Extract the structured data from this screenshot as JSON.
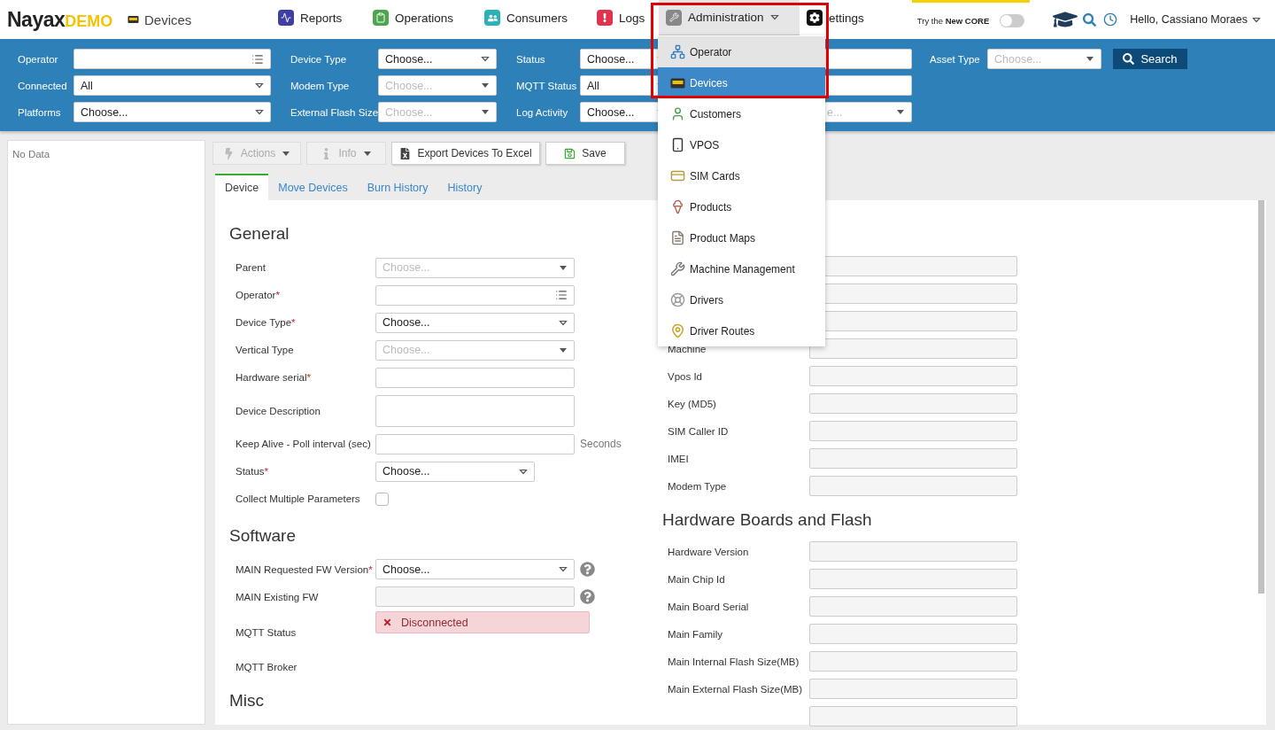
{
  "header": {
    "logo": {
      "brand": "Nayax",
      "badge": "DEMO"
    },
    "page_title": "Devices",
    "nav": [
      {
        "label": "Reports",
        "kind": "reports",
        "selected": false
      },
      {
        "label": "Operations",
        "kind": "operations",
        "selected": false
      },
      {
        "label": "Consumers",
        "kind": "consumers",
        "selected": false
      },
      {
        "label": "Logs",
        "kind": "logs",
        "selected": false
      },
      {
        "label": "Administration",
        "kind": "administration",
        "selected": true
      },
      {
        "label": "ettings",
        "kind": "settings",
        "selected": false
      }
    ],
    "try_core": {
      "label": "Try the **New CORE**",
      "on": false
    },
    "greeting": "Hello, Cassiano Moraes"
  },
  "filters": {
    "columns": [
      {
        "rows": [
          {
            "label": "Operator",
            "kind": "list"
          },
          {
            "label": "Connected",
            "kind": "select",
            "value": "All"
          },
          {
            "label": "Platforms",
            "kind": "select",
            "value": "Choose..."
          }
        ]
      },
      {
        "rows": [
          {
            "label": "Device Type",
            "kind": "select",
            "value": "Choose..."
          },
          {
            "label": "Modem Type",
            "kind": "select",
            "placeholder": "Choose..."
          },
          {
            "label": "External Flash Size",
            "kind": "select",
            "placeholder": "Choose..."
          }
        ]
      },
      {
        "rows": [
          {
            "label": "Status",
            "kind": "select",
            "value": "Choose..."
          },
          {
            "label": "MQTT Status",
            "kind": "select",
            "value": "All"
          },
          {
            "label": "Log Activity",
            "kind": "select",
            "value": "Choose..."
          }
        ]
      },
      {
        "rows": [
          {
            "kind": "text"
          },
          {
            "kind": "text"
          },
          {
            "kind": "select",
            "placeholder": "e..."
          }
        ]
      },
      {
        "rows": [
          {
            "label": "Asset Type",
            "kind": "select",
            "placeholder": "Choose..."
          }
        ]
      }
    ],
    "search_button": "Search"
  },
  "tree_panel": {
    "empty_text": "No Data"
  },
  "toolbar": [
    {
      "label": "Actions",
      "kind": "actions",
      "disabled": true
    },
    {
      "label": "Info",
      "kind": "info",
      "disabled": true
    },
    {
      "label": "Export Devices To Excel",
      "kind": "export",
      "disabled": false
    },
    {
      "label": "Save",
      "kind": "save",
      "disabled": false
    }
  ],
  "tabs": [
    {
      "label": "Device",
      "selected": true
    },
    {
      "label": "Move Devices",
      "selected": false
    },
    {
      "label": "Burn History",
      "selected": false
    },
    {
      "label": "History",
      "selected": false
    }
  ],
  "form": {
    "left": [
      {
        "title": "General",
        "fields": [
          {
            "label": "Parent",
            "kind": "select",
            "placeholder": "Choose..."
          },
          {
            "label": "Operator",
            "mark": "*",
            "kind": "list"
          },
          {
            "label": "Device Type",
            "mark": "*",
            "kind": "select",
            "value": "Choose..."
          },
          {
            "label": "Vertical Type",
            "kind": "select",
            "placeholder": "Choose..."
          },
          {
            "label": "Hardware serial",
            "mark": "*",
            "kind": "text"
          },
          {
            "label": "Device Description",
            "kind": "textarea"
          },
          {
            "label": "Keep Alive - Poll interval (sec)",
            "kind": "text",
            "suffix": "Seconds"
          },
          {
            "label": "Status",
            "mark": "*",
            "kind": "shortselect",
            "value": "Choose..."
          },
          {
            "label": "Collect Multiple Parameters",
            "kind": "checkbox",
            "checked": false
          }
        ]
      },
      {
        "title": "Software",
        "fields": [
          {
            "label": "MAIN Requested FW Version",
            "mark": "*",
            "kind": "select",
            "value": "Choose...",
            "help": true
          },
          {
            "label": "MAIN Existing FW",
            "kind": "readonly",
            "help": true
          },
          {
            "label": "MQTT Status",
            "kind": "status",
            "value": "Disconnected"
          },
          {
            "label": "MQTT Broker",
            "kind": "empty"
          }
        ]
      },
      {
        "title": "Misc"
      }
    ],
    "right": [
      {
        "fields": [
          {
            "kind": "readonly"
          },
          {
            "kind": "readonly"
          },
          {
            "kind": "readonly"
          },
          {
            "label": "Machine",
            "kind": "readonly"
          },
          {
            "label": "Vpos Id",
            "kind": "readonly"
          },
          {
            "label": "Key (MD5)",
            "kind": "readonly"
          },
          {
            "label": "SIM Caller ID",
            "kind": "readonly"
          },
          {
            "label": "IMEI",
            "kind": "readonly"
          },
          {
            "label": "Modem Type",
            "kind": "readonly"
          }
        ]
      },
      {
        "title": "Hardware Boards and Flash",
        "fields": [
          {
            "label": "Hardware Version",
            "kind": "readonly"
          },
          {
            "label": "Main Chip Id",
            "kind": "readonly"
          },
          {
            "label": "Main Board Serial",
            "kind": "readonly"
          },
          {
            "label": "Main Family",
            "kind": "readonly"
          },
          {
            "label": "Main Internal Flash Size(MB)",
            "kind": "readonly"
          },
          {
            "label": "Main External Flash Size(MB)",
            "kind": "readonly"
          },
          {
            "kind": "readonly"
          }
        ]
      }
    ]
  },
  "admin_menu": [
    {
      "label": "Operator",
      "kind": "operator",
      "highlighted": true,
      "selected": false
    },
    {
      "label": "Devices",
      "kind": "devices",
      "highlighted": false,
      "selected": true
    },
    {
      "label": "Customers",
      "kind": "customers",
      "highlighted": false,
      "selected": false
    },
    {
      "label": "VPOS",
      "kind": "vpos",
      "highlighted": false,
      "selected": false
    },
    {
      "label": "SIM Cards",
      "kind": "sim",
      "highlighted": false,
      "selected": false
    },
    {
      "label": "Products",
      "kind": "products",
      "highlighted": false,
      "selected": false
    },
    {
      "label": "Product Maps",
      "kind": "maps",
      "highlighted": false,
      "selected": false
    },
    {
      "label": "Machine Management",
      "kind": "machines",
      "highlighted": false,
      "selected": false
    },
    {
      "label": "Drivers",
      "kind": "drivers",
      "highlighted": false,
      "selected": false
    },
    {
      "label": "Driver Routes",
      "kind": "routes",
      "highlighted": false,
      "selected": false
    }
  ]
}
